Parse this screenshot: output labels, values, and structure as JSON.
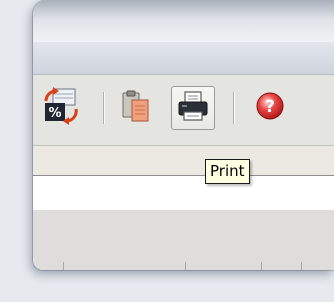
{
  "toolbar": {
    "buttons": [
      {
        "name": "convert-percent-button",
        "icon": "percent-refresh-icon"
      },
      {
        "name": "paste-button",
        "icon": "clipboard-paste-icon"
      },
      {
        "name": "print-button",
        "icon": "printer-icon"
      },
      {
        "name": "help-button",
        "icon": "help-question-icon"
      }
    ]
  },
  "tooltip": {
    "text": "Print"
  },
  "colors": {
    "tooltip_bg": "#ffffe1",
    "help_red": "#d42a2a",
    "refresh_red": "#d8401c"
  }
}
